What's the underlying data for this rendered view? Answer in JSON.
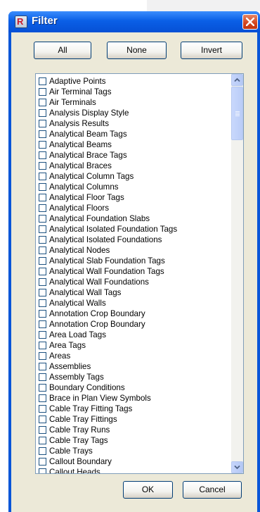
{
  "window": {
    "title": "Filter",
    "app_icon_letter": "R",
    "close_icon": "close-icon"
  },
  "toolbar": {
    "all_label": "All",
    "none_label": "None",
    "invert_label": "Invert"
  },
  "list": {
    "items": [
      {
        "label": "Adaptive Points",
        "checked": false
      },
      {
        "label": "Air Terminal Tags",
        "checked": false
      },
      {
        "label": "Air Terminals",
        "checked": false
      },
      {
        "label": "Analysis Display Style",
        "checked": false
      },
      {
        "label": "Analysis Results",
        "checked": false
      },
      {
        "label": "Analytical Beam Tags",
        "checked": false
      },
      {
        "label": "Analytical Beams",
        "checked": false
      },
      {
        "label": "Analytical Brace Tags",
        "checked": false
      },
      {
        "label": "Analytical Braces",
        "checked": false
      },
      {
        "label": "Analytical Column Tags",
        "checked": false
      },
      {
        "label": "Analytical Columns",
        "checked": false
      },
      {
        "label": "Analytical Floor Tags",
        "checked": false
      },
      {
        "label": "Analytical Floors",
        "checked": false
      },
      {
        "label": "Analytical Foundation Slabs",
        "checked": false
      },
      {
        "label": "Analytical Isolated Foundation Tags",
        "checked": false
      },
      {
        "label": "Analytical Isolated Foundations",
        "checked": false
      },
      {
        "label": "Analytical Nodes",
        "checked": false
      },
      {
        "label": "Analytical Slab Foundation Tags",
        "checked": false
      },
      {
        "label": "Analytical Wall Foundation Tags",
        "checked": false
      },
      {
        "label": "Analytical Wall Foundations",
        "checked": false
      },
      {
        "label": "Analytical Wall Tags",
        "checked": false
      },
      {
        "label": "Analytical Walls",
        "checked": false
      },
      {
        "label": "Annotation Crop Boundary",
        "checked": false
      },
      {
        "label": "Annotation Crop Boundary",
        "checked": false
      },
      {
        "label": "Area Load Tags",
        "checked": false
      },
      {
        "label": "Area Tags",
        "checked": false
      },
      {
        "label": "Areas",
        "checked": false
      },
      {
        "label": "Assemblies",
        "checked": false
      },
      {
        "label": "Assembly Tags",
        "checked": false
      },
      {
        "label": "Boundary Conditions",
        "checked": false
      },
      {
        "label": "Brace in Plan View Symbols",
        "checked": false
      },
      {
        "label": "Cable Tray Fitting Tags",
        "checked": false
      },
      {
        "label": "Cable Tray Fittings",
        "checked": false
      },
      {
        "label": "Cable Tray Runs",
        "checked": false
      },
      {
        "label": "Cable Tray Tags",
        "checked": false
      },
      {
        "label": "Cable Trays",
        "checked": false
      },
      {
        "label": "Callout Boundary",
        "checked": false
      },
      {
        "label": "Callout Heads",
        "checked": false
      }
    ]
  },
  "footer": {
    "ok_label": "OK",
    "cancel_label": "Cancel"
  }
}
